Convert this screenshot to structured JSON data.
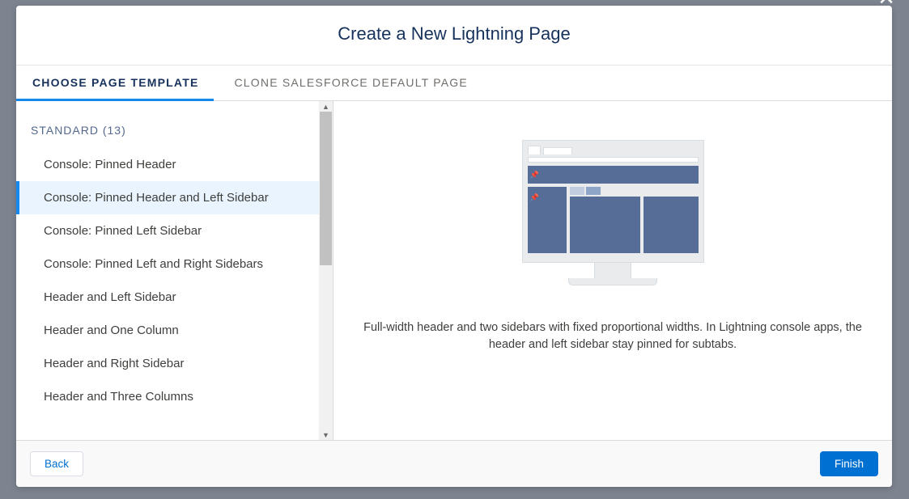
{
  "header": {
    "title": "Create a New Lightning Page"
  },
  "tabs": [
    {
      "label": "CHOOSE PAGE TEMPLATE",
      "active": true
    },
    {
      "label": "CLONE SALESFORCE DEFAULT PAGE",
      "active": false
    }
  ],
  "group": {
    "label": "STANDARD (13)"
  },
  "templates": [
    {
      "label": "Console: Pinned Header",
      "selected": false
    },
    {
      "label": "Console: Pinned Header and Left Sidebar",
      "selected": true
    },
    {
      "label": "Console: Pinned Left Sidebar",
      "selected": false
    },
    {
      "label": "Console: Pinned Left and Right Sidebars",
      "selected": false
    },
    {
      "label": "Header and Left Sidebar",
      "selected": false
    },
    {
      "label": "Header and One Column",
      "selected": false
    },
    {
      "label": "Header and Right Sidebar",
      "selected": false
    },
    {
      "label": "Header and Three Columns",
      "selected": false
    }
  ],
  "preview": {
    "description": "Full-width header and two sidebars with fixed proportional widths. In Lightning console apps, the header and left sidebar stay pinned for subtabs."
  },
  "footer": {
    "back_label": "Back",
    "finish_label": "Finish"
  }
}
